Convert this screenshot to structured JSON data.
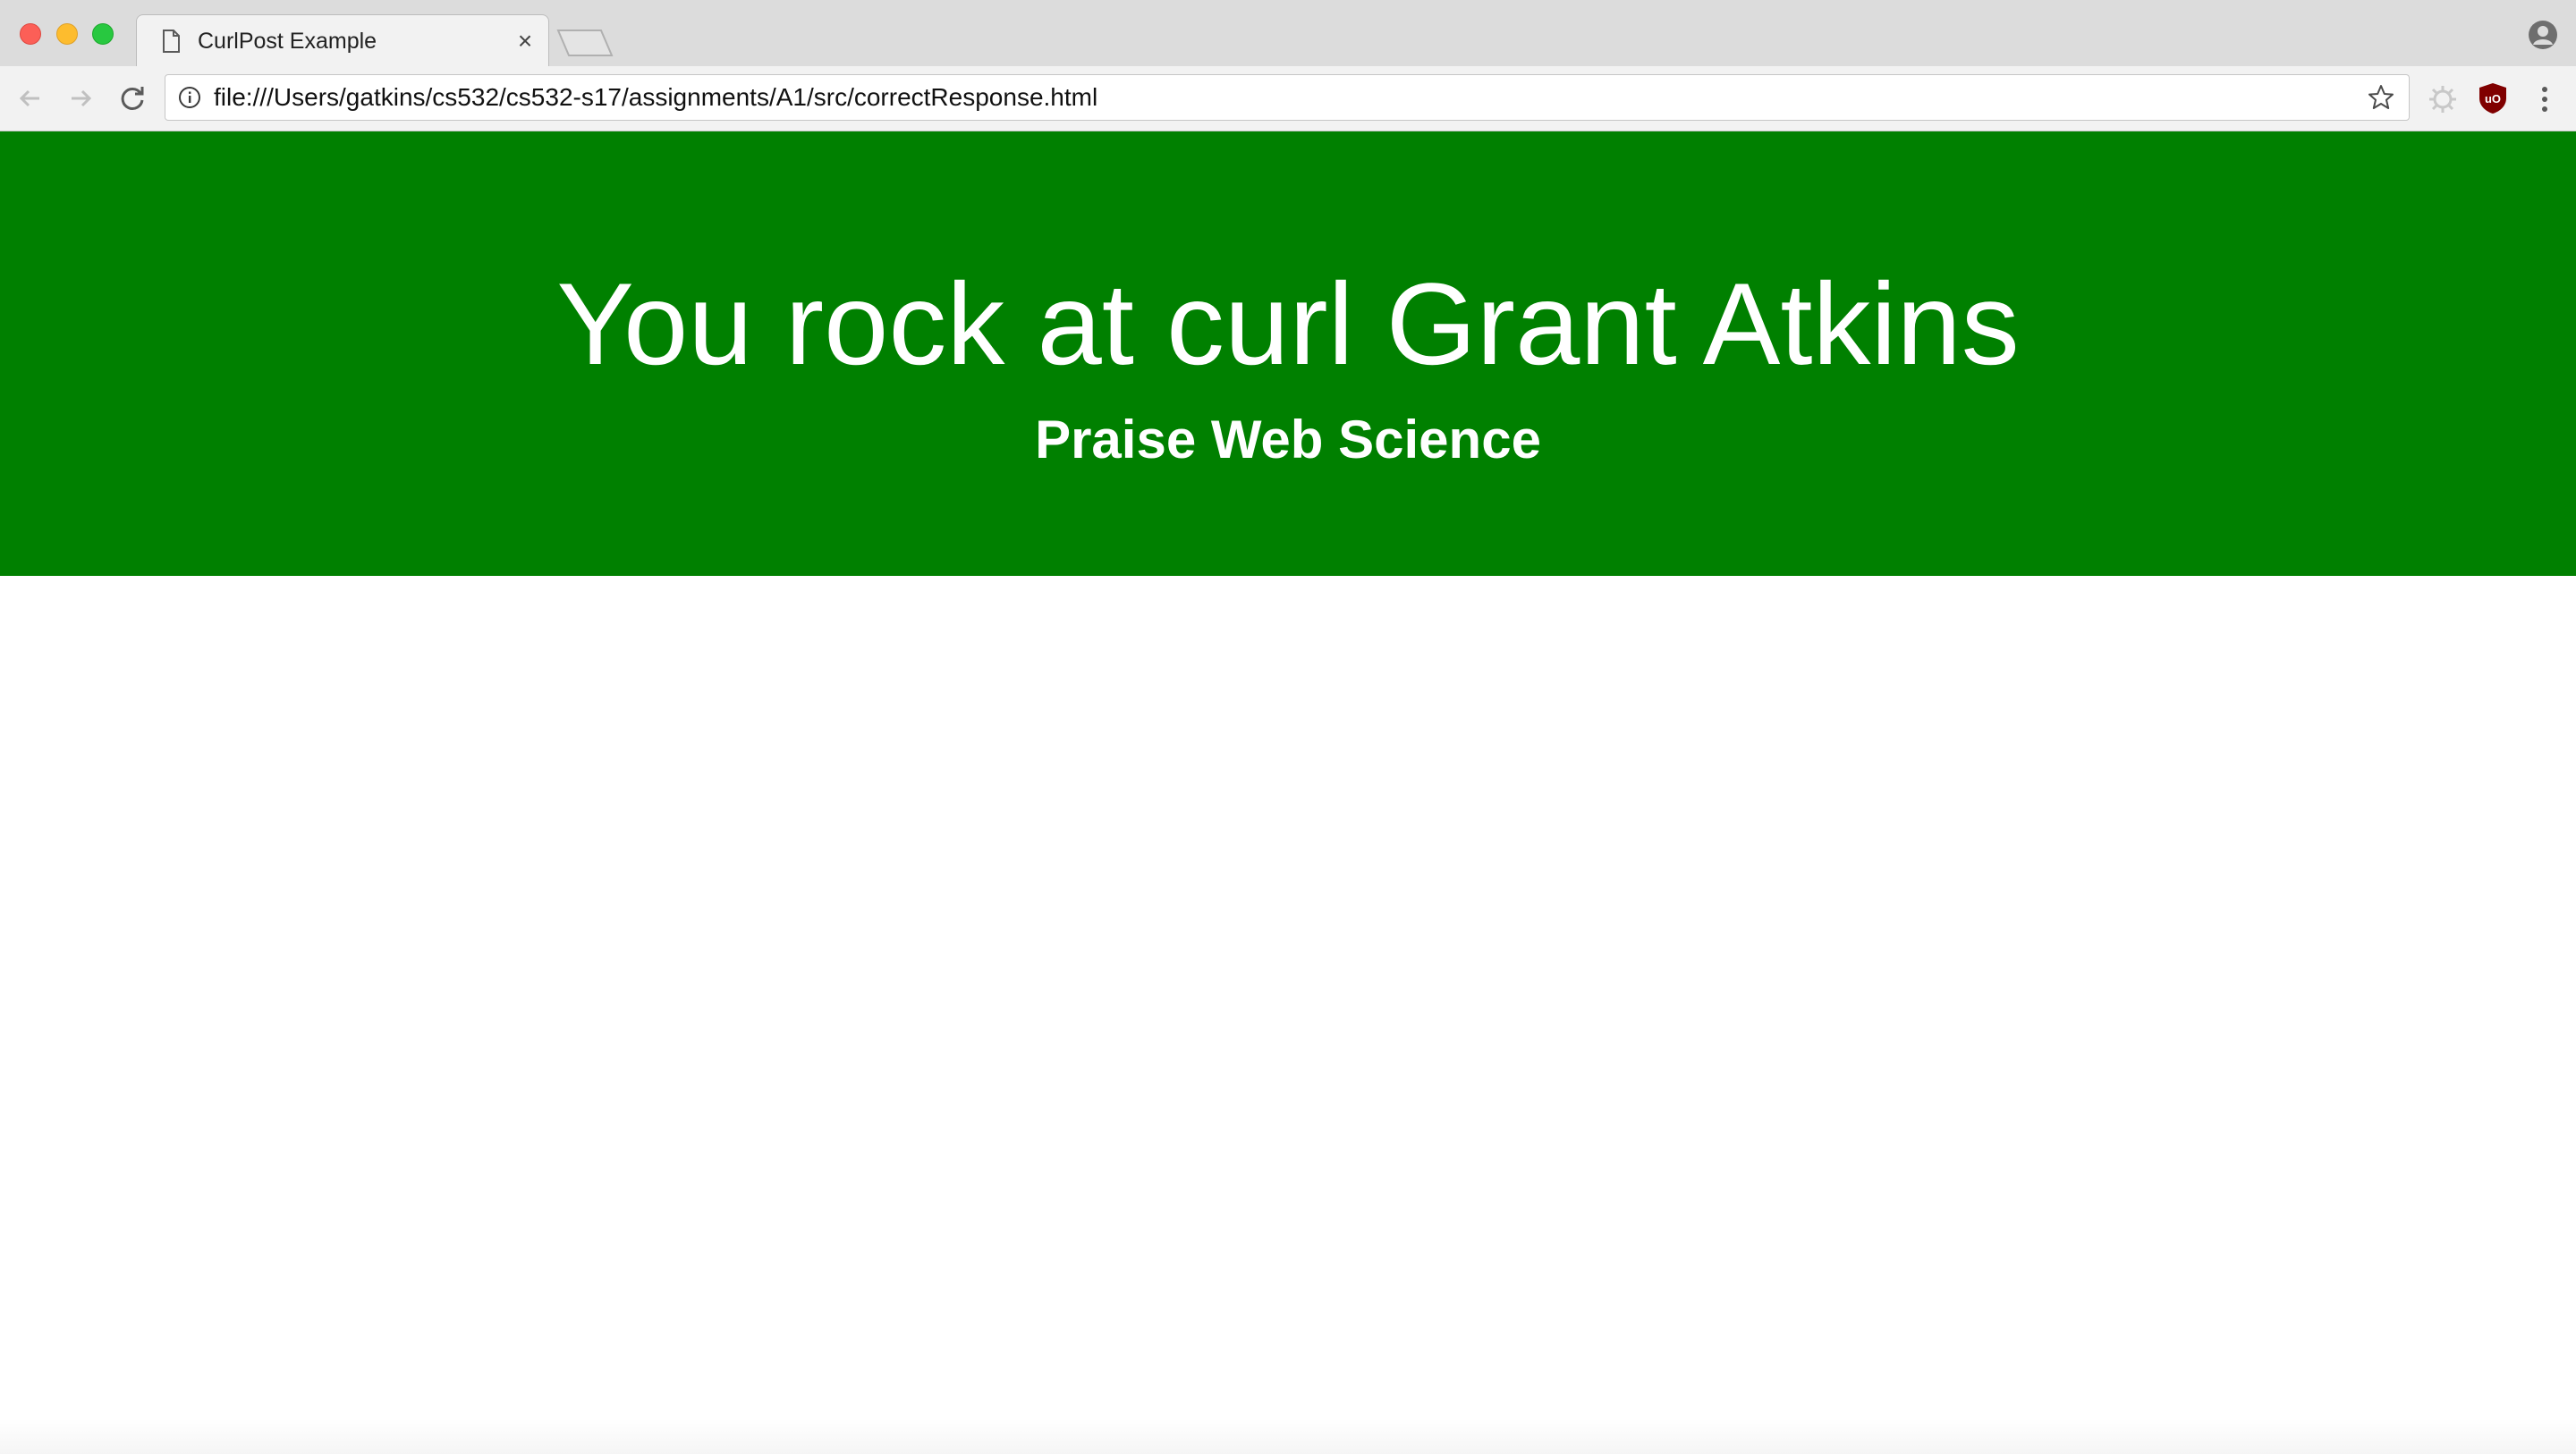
{
  "browser": {
    "tab": {
      "title": "CurlPost Example",
      "close_glyph": "×",
      "icon": "document-icon"
    },
    "toolbar": {
      "url": "file:///Users/gatkins/cs532/cs532-s17/assignments/A1/src/correctResponse.html",
      "icons": [
        "back-arrow-icon",
        "forward-arrow-icon",
        "reload-icon",
        "info-icon",
        "star-icon",
        "extension-icon",
        "ublock-icon",
        "menu-icon"
      ]
    },
    "colors": {
      "close": "#fc5f57",
      "minimize": "#fdbc2e",
      "maximize": "#28c840"
    }
  },
  "page": {
    "headline": "You rock at curl Grant Atkins",
    "subheadline": "Praise Web Science",
    "colors": {
      "banner_background": "#008000",
      "banner_text": "#ffffff",
      "body_background": "#ffffff"
    }
  }
}
